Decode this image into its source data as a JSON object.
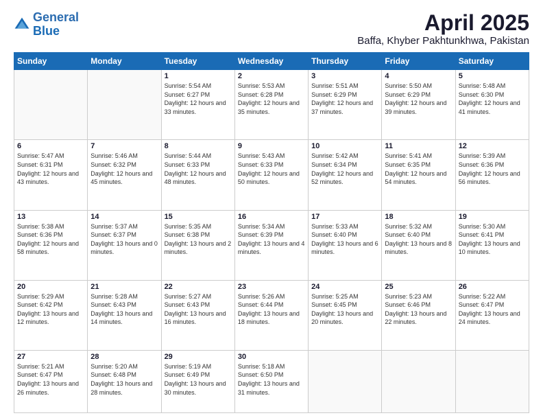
{
  "logo": {
    "line1": "General",
    "line2": "Blue"
  },
  "title": "April 2025",
  "subtitle": "Baffa, Khyber Pakhtunkhwa, Pakistan",
  "days_header": [
    "Sunday",
    "Monday",
    "Tuesday",
    "Wednesday",
    "Thursday",
    "Friday",
    "Saturday"
  ],
  "weeks": [
    [
      {
        "day": "",
        "sunrise": "",
        "sunset": "",
        "daylight": ""
      },
      {
        "day": "",
        "sunrise": "",
        "sunset": "",
        "daylight": ""
      },
      {
        "day": "1",
        "sunrise": "Sunrise: 5:54 AM",
        "sunset": "Sunset: 6:27 PM",
        "daylight": "Daylight: 12 hours and 33 minutes."
      },
      {
        "day": "2",
        "sunrise": "Sunrise: 5:53 AM",
        "sunset": "Sunset: 6:28 PM",
        "daylight": "Daylight: 12 hours and 35 minutes."
      },
      {
        "day": "3",
        "sunrise": "Sunrise: 5:51 AM",
        "sunset": "Sunset: 6:29 PM",
        "daylight": "Daylight: 12 hours and 37 minutes."
      },
      {
        "day": "4",
        "sunrise": "Sunrise: 5:50 AM",
        "sunset": "Sunset: 6:29 PM",
        "daylight": "Daylight: 12 hours and 39 minutes."
      },
      {
        "day": "5",
        "sunrise": "Sunrise: 5:48 AM",
        "sunset": "Sunset: 6:30 PM",
        "daylight": "Daylight: 12 hours and 41 minutes."
      }
    ],
    [
      {
        "day": "6",
        "sunrise": "Sunrise: 5:47 AM",
        "sunset": "Sunset: 6:31 PM",
        "daylight": "Daylight: 12 hours and 43 minutes."
      },
      {
        "day": "7",
        "sunrise": "Sunrise: 5:46 AM",
        "sunset": "Sunset: 6:32 PM",
        "daylight": "Daylight: 12 hours and 45 minutes."
      },
      {
        "day": "8",
        "sunrise": "Sunrise: 5:44 AM",
        "sunset": "Sunset: 6:33 PM",
        "daylight": "Daylight: 12 hours and 48 minutes."
      },
      {
        "day": "9",
        "sunrise": "Sunrise: 5:43 AM",
        "sunset": "Sunset: 6:33 PM",
        "daylight": "Daylight: 12 hours and 50 minutes."
      },
      {
        "day": "10",
        "sunrise": "Sunrise: 5:42 AM",
        "sunset": "Sunset: 6:34 PM",
        "daylight": "Daylight: 12 hours and 52 minutes."
      },
      {
        "day": "11",
        "sunrise": "Sunrise: 5:41 AM",
        "sunset": "Sunset: 6:35 PM",
        "daylight": "Daylight: 12 hours and 54 minutes."
      },
      {
        "day": "12",
        "sunrise": "Sunrise: 5:39 AM",
        "sunset": "Sunset: 6:36 PM",
        "daylight": "Daylight: 12 hours and 56 minutes."
      }
    ],
    [
      {
        "day": "13",
        "sunrise": "Sunrise: 5:38 AM",
        "sunset": "Sunset: 6:36 PM",
        "daylight": "Daylight: 12 hours and 58 minutes."
      },
      {
        "day": "14",
        "sunrise": "Sunrise: 5:37 AM",
        "sunset": "Sunset: 6:37 PM",
        "daylight": "Daylight: 13 hours and 0 minutes."
      },
      {
        "day": "15",
        "sunrise": "Sunrise: 5:35 AM",
        "sunset": "Sunset: 6:38 PM",
        "daylight": "Daylight: 13 hours and 2 minutes."
      },
      {
        "day": "16",
        "sunrise": "Sunrise: 5:34 AM",
        "sunset": "Sunset: 6:39 PM",
        "daylight": "Daylight: 13 hours and 4 minutes."
      },
      {
        "day": "17",
        "sunrise": "Sunrise: 5:33 AM",
        "sunset": "Sunset: 6:40 PM",
        "daylight": "Daylight: 13 hours and 6 minutes."
      },
      {
        "day": "18",
        "sunrise": "Sunrise: 5:32 AM",
        "sunset": "Sunset: 6:40 PM",
        "daylight": "Daylight: 13 hours and 8 minutes."
      },
      {
        "day": "19",
        "sunrise": "Sunrise: 5:30 AM",
        "sunset": "Sunset: 6:41 PM",
        "daylight": "Daylight: 13 hours and 10 minutes."
      }
    ],
    [
      {
        "day": "20",
        "sunrise": "Sunrise: 5:29 AM",
        "sunset": "Sunset: 6:42 PM",
        "daylight": "Daylight: 13 hours and 12 minutes."
      },
      {
        "day": "21",
        "sunrise": "Sunrise: 5:28 AM",
        "sunset": "Sunset: 6:43 PM",
        "daylight": "Daylight: 13 hours and 14 minutes."
      },
      {
        "day": "22",
        "sunrise": "Sunrise: 5:27 AM",
        "sunset": "Sunset: 6:43 PM",
        "daylight": "Daylight: 13 hours and 16 minutes."
      },
      {
        "day": "23",
        "sunrise": "Sunrise: 5:26 AM",
        "sunset": "Sunset: 6:44 PM",
        "daylight": "Daylight: 13 hours and 18 minutes."
      },
      {
        "day": "24",
        "sunrise": "Sunrise: 5:25 AM",
        "sunset": "Sunset: 6:45 PM",
        "daylight": "Daylight: 13 hours and 20 minutes."
      },
      {
        "day": "25",
        "sunrise": "Sunrise: 5:23 AM",
        "sunset": "Sunset: 6:46 PM",
        "daylight": "Daylight: 13 hours and 22 minutes."
      },
      {
        "day": "26",
        "sunrise": "Sunrise: 5:22 AM",
        "sunset": "Sunset: 6:47 PM",
        "daylight": "Daylight: 13 hours and 24 minutes."
      }
    ],
    [
      {
        "day": "27",
        "sunrise": "Sunrise: 5:21 AM",
        "sunset": "Sunset: 6:47 PM",
        "daylight": "Daylight: 13 hours and 26 minutes."
      },
      {
        "day": "28",
        "sunrise": "Sunrise: 5:20 AM",
        "sunset": "Sunset: 6:48 PM",
        "daylight": "Daylight: 13 hours and 28 minutes."
      },
      {
        "day": "29",
        "sunrise": "Sunrise: 5:19 AM",
        "sunset": "Sunset: 6:49 PM",
        "daylight": "Daylight: 13 hours and 30 minutes."
      },
      {
        "day": "30",
        "sunrise": "Sunrise: 5:18 AM",
        "sunset": "Sunset: 6:50 PM",
        "daylight": "Daylight: 13 hours and 31 minutes."
      },
      {
        "day": "",
        "sunrise": "",
        "sunset": "",
        "daylight": ""
      },
      {
        "day": "",
        "sunrise": "",
        "sunset": "",
        "daylight": ""
      },
      {
        "day": "",
        "sunrise": "",
        "sunset": "",
        "daylight": ""
      }
    ]
  ]
}
